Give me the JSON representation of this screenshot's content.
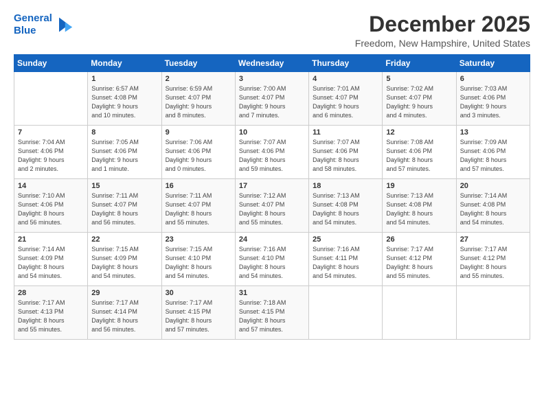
{
  "logo": {
    "line1": "General",
    "line2": "Blue"
  },
  "title": "December 2025",
  "location": "Freedom, New Hampshire, United States",
  "header_days": [
    "Sunday",
    "Monday",
    "Tuesday",
    "Wednesday",
    "Thursday",
    "Friday",
    "Saturday"
  ],
  "weeks": [
    [
      {
        "day": "",
        "content": ""
      },
      {
        "day": "1",
        "content": "Sunrise: 6:57 AM\nSunset: 4:08 PM\nDaylight: 9 hours\nand 10 minutes."
      },
      {
        "day": "2",
        "content": "Sunrise: 6:59 AM\nSunset: 4:07 PM\nDaylight: 9 hours\nand 8 minutes."
      },
      {
        "day": "3",
        "content": "Sunrise: 7:00 AM\nSunset: 4:07 PM\nDaylight: 9 hours\nand 7 minutes."
      },
      {
        "day": "4",
        "content": "Sunrise: 7:01 AM\nSunset: 4:07 PM\nDaylight: 9 hours\nand 6 minutes."
      },
      {
        "day": "5",
        "content": "Sunrise: 7:02 AM\nSunset: 4:07 PM\nDaylight: 9 hours\nand 4 minutes."
      },
      {
        "day": "6",
        "content": "Sunrise: 7:03 AM\nSunset: 4:06 PM\nDaylight: 9 hours\nand 3 minutes."
      }
    ],
    [
      {
        "day": "7",
        "content": "Sunrise: 7:04 AM\nSunset: 4:06 PM\nDaylight: 9 hours\nand 2 minutes."
      },
      {
        "day": "8",
        "content": "Sunrise: 7:05 AM\nSunset: 4:06 PM\nDaylight: 9 hours\nand 1 minute."
      },
      {
        "day": "9",
        "content": "Sunrise: 7:06 AM\nSunset: 4:06 PM\nDaylight: 9 hours\nand 0 minutes."
      },
      {
        "day": "10",
        "content": "Sunrise: 7:07 AM\nSunset: 4:06 PM\nDaylight: 8 hours\nand 59 minutes."
      },
      {
        "day": "11",
        "content": "Sunrise: 7:07 AM\nSunset: 4:06 PM\nDaylight: 8 hours\nand 58 minutes."
      },
      {
        "day": "12",
        "content": "Sunrise: 7:08 AM\nSunset: 4:06 PM\nDaylight: 8 hours\nand 57 minutes."
      },
      {
        "day": "13",
        "content": "Sunrise: 7:09 AM\nSunset: 4:06 PM\nDaylight: 8 hours\nand 57 minutes."
      }
    ],
    [
      {
        "day": "14",
        "content": "Sunrise: 7:10 AM\nSunset: 4:06 PM\nDaylight: 8 hours\nand 56 minutes."
      },
      {
        "day": "15",
        "content": "Sunrise: 7:11 AM\nSunset: 4:07 PM\nDaylight: 8 hours\nand 56 minutes."
      },
      {
        "day": "16",
        "content": "Sunrise: 7:11 AM\nSunset: 4:07 PM\nDaylight: 8 hours\nand 55 minutes."
      },
      {
        "day": "17",
        "content": "Sunrise: 7:12 AM\nSunset: 4:07 PM\nDaylight: 8 hours\nand 55 minutes."
      },
      {
        "day": "18",
        "content": "Sunrise: 7:13 AM\nSunset: 4:08 PM\nDaylight: 8 hours\nand 54 minutes."
      },
      {
        "day": "19",
        "content": "Sunrise: 7:13 AM\nSunset: 4:08 PM\nDaylight: 8 hours\nand 54 minutes."
      },
      {
        "day": "20",
        "content": "Sunrise: 7:14 AM\nSunset: 4:08 PM\nDaylight: 8 hours\nand 54 minutes."
      }
    ],
    [
      {
        "day": "21",
        "content": "Sunrise: 7:14 AM\nSunset: 4:09 PM\nDaylight: 8 hours\nand 54 minutes."
      },
      {
        "day": "22",
        "content": "Sunrise: 7:15 AM\nSunset: 4:09 PM\nDaylight: 8 hours\nand 54 minutes."
      },
      {
        "day": "23",
        "content": "Sunrise: 7:15 AM\nSunset: 4:10 PM\nDaylight: 8 hours\nand 54 minutes."
      },
      {
        "day": "24",
        "content": "Sunrise: 7:16 AM\nSunset: 4:10 PM\nDaylight: 8 hours\nand 54 minutes."
      },
      {
        "day": "25",
        "content": "Sunrise: 7:16 AM\nSunset: 4:11 PM\nDaylight: 8 hours\nand 54 minutes."
      },
      {
        "day": "26",
        "content": "Sunrise: 7:17 AM\nSunset: 4:12 PM\nDaylight: 8 hours\nand 55 minutes."
      },
      {
        "day": "27",
        "content": "Sunrise: 7:17 AM\nSunset: 4:12 PM\nDaylight: 8 hours\nand 55 minutes."
      }
    ],
    [
      {
        "day": "28",
        "content": "Sunrise: 7:17 AM\nSunset: 4:13 PM\nDaylight: 8 hours\nand 55 minutes."
      },
      {
        "day": "29",
        "content": "Sunrise: 7:17 AM\nSunset: 4:14 PM\nDaylight: 8 hours\nand 56 minutes."
      },
      {
        "day": "30",
        "content": "Sunrise: 7:17 AM\nSunset: 4:15 PM\nDaylight: 8 hours\nand 57 minutes."
      },
      {
        "day": "31",
        "content": "Sunrise: 7:18 AM\nSunset: 4:15 PM\nDaylight: 8 hours\nand 57 minutes."
      },
      {
        "day": "",
        "content": ""
      },
      {
        "day": "",
        "content": ""
      },
      {
        "day": "",
        "content": ""
      }
    ]
  ]
}
